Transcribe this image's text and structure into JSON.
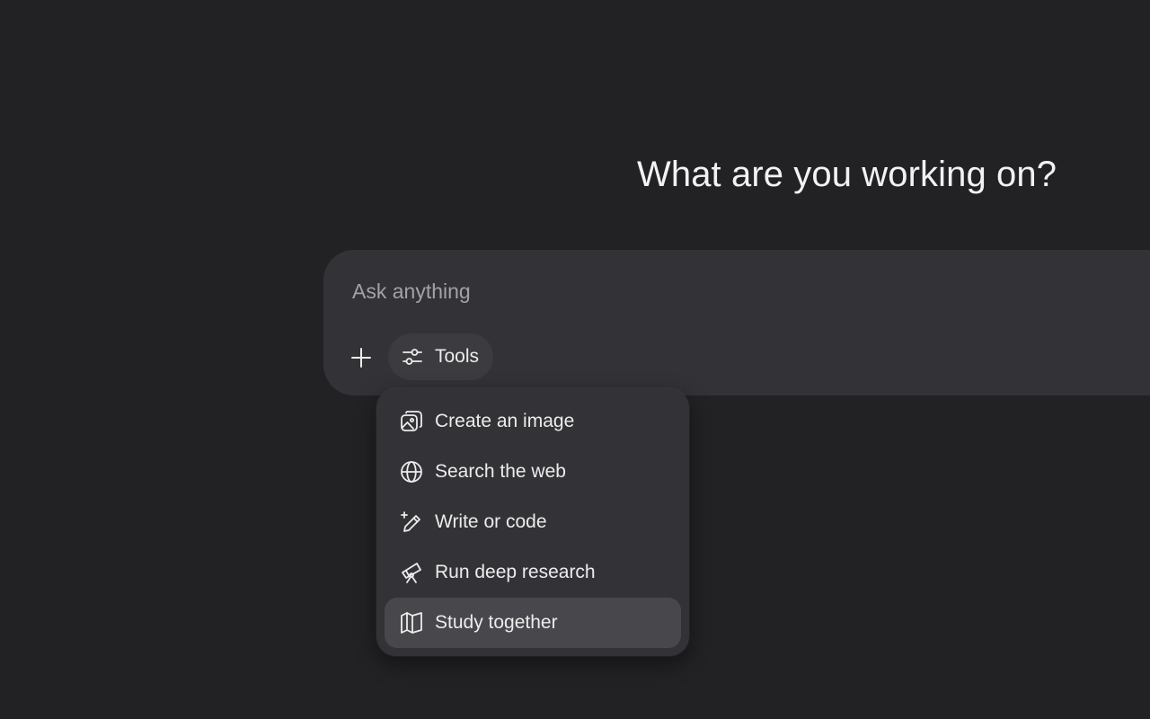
{
  "heading": "What are you working on?",
  "composer": {
    "placeholder": "Ask anything",
    "value": "",
    "add_icon": "plus-icon",
    "tools_label": "Tools",
    "tools_icon": "sliders-icon"
  },
  "tools_menu": {
    "items": [
      {
        "label": "Create an image",
        "icon": "image-icon",
        "active": false
      },
      {
        "label": "Search the web",
        "icon": "globe-icon",
        "active": false
      },
      {
        "label": "Write or code",
        "icon": "pen-sparkle-icon",
        "active": false
      },
      {
        "label": "Run deep research",
        "icon": "telescope-icon",
        "active": false
      },
      {
        "label": "Study together",
        "icon": "book-open-icon",
        "active": true
      }
    ]
  },
  "colors": {
    "background": "#222124",
    "composer": "#333236",
    "menu_highlight": "#48474b",
    "text": "#ececec",
    "placeholder": "#a3a3a6"
  }
}
